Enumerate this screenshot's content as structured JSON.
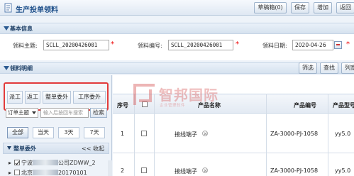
{
  "app": {
    "title": "生产投单领料"
  },
  "toolbar": {
    "draft": "草稿箱(0)",
    "save": "保存",
    "add": "增加",
    "more": "返回"
  },
  "basic_section": {
    "title": "基本信息"
  },
  "form": {
    "subject_label": "领料主题:",
    "subject_value": "SCLL_20200426001",
    "code_label": "领料编号:",
    "code_value": "SCLL_20200426001",
    "date_label": "领料日期:",
    "date_value": "2020-04-26"
  },
  "detail_section": {
    "title": "领料明细",
    "filter": "筛选",
    "find": "查找",
    "cols": "列宽"
  },
  "left_tabs": [
    "派工",
    "返工",
    "整单委外",
    "工序委外"
  ],
  "filter": {
    "select_value": "订单主题",
    "search_placeholder": "输入后按回车搜索",
    "search_btn": "检索"
  },
  "date_tabs": [
    "全部",
    "当天",
    "3天",
    "7天"
  ],
  "group": {
    "title": "整单委外",
    "collapse": "<< 收起"
  },
  "tree": [
    {
      "text": "宁波",
      "tail": "公司ZDWW_2",
      "checked": true
    },
    {
      "text": "北京",
      "tail": "20170101",
      "checked": false
    }
  ],
  "table": {
    "headers": [
      "序号",
      "产品名称",
      "产品编号",
      "产品型号"
    ],
    "rows": [
      {
        "index": "1",
        "name": "接线端子",
        "code": "ZA-3000-PJ-1058",
        "model": "yy5.0"
      },
      {
        "index": "2",
        "name": "接线端子",
        "code": "ZA-3000-PJ-1058",
        "model": "yy5.0"
      }
    ]
  },
  "watermark": {
    "big": "智邦国际",
    "small": "企业管理软件"
  }
}
